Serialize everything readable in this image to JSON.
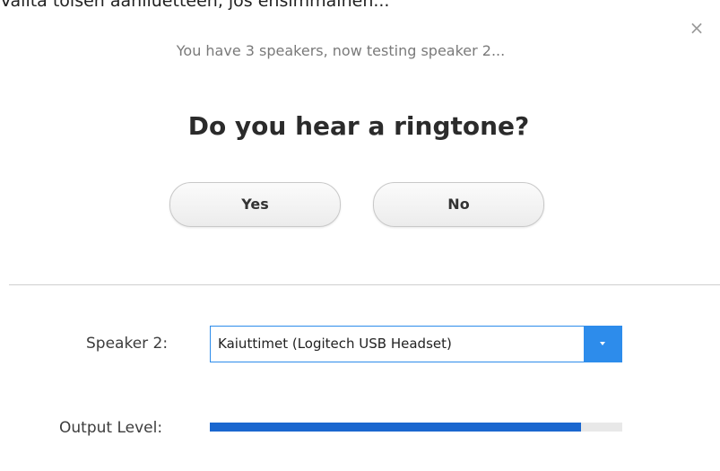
{
  "background_caption": "Valita toisen ääniluetteen, jos ensimmäinen...",
  "dialog": {
    "close_glyph": "×",
    "status_text": "You have 3 speakers, now testing speaker 2...",
    "question": "Do you hear a ringtone?",
    "buttons": {
      "yes_label": "Yes",
      "no_label": "No"
    },
    "speaker": {
      "label": "Speaker 2:",
      "selected": "Kaiuttimet (Logitech USB Headset)",
      "arrow_color": "#2d8ceb"
    },
    "output_level": {
      "label": "Output Level:",
      "level": 0.9,
      "fill_color": "#1a67cf"
    }
  }
}
